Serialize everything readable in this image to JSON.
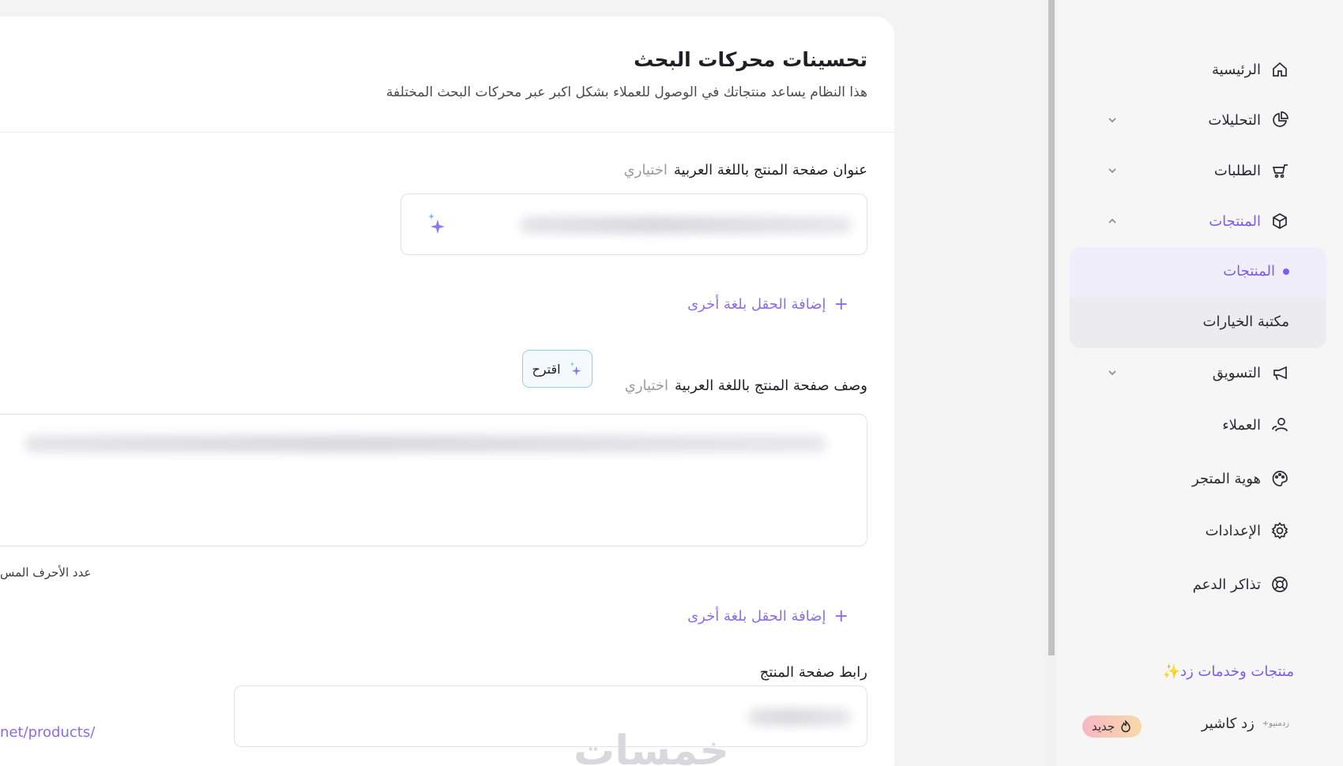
{
  "seo": {
    "title": "تحسينات محركات البحث",
    "subtitle": "هذا النظام يساعد منتجاتك في الوصول للعملاء بشكل اكبر عبر محركات البحث المختلفة",
    "title_field": {
      "label": "عنوان صفحة المنتج باللغة العربية",
      "optional": "اختياري"
    },
    "add_language_label": "إضافة الحقل بلغة أخرى",
    "description_field": {
      "label": "وصف صفحة المنتج باللغة العربية",
      "optional": "اختياري"
    },
    "suggest_label": "اقترح",
    "char_count_label": "عدد الأحرف المس",
    "url_field": {
      "label": "رابط صفحة المنتج",
      "prefix": "net/products/"
    },
    "watermark": "خمسات"
  },
  "sidebar": {
    "items": [
      {
        "label": "الرئيسية",
        "icon": "home-icon"
      },
      {
        "label": "التحليلات",
        "icon": "pie-chart-icon",
        "chevron": "down"
      },
      {
        "label": "الطلبات",
        "icon": "cart-icon",
        "chevron": "down"
      },
      {
        "label": "المنتجات",
        "icon": "box-icon",
        "chevron": "up",
        "active": true
      },
      {
        "label": "التسويق",
        "icon": "megaphone-icon",
        "chevron": "down"
      },
      {
        "label": "العملاء",
        "icon": "users-icon"
      },
      {
        "label": "هوية المتجر",
        "icon": "palette-icon"
      },
      {
        "label": "الإعدادات",
        "icon": "gear-icon"
      },
      {
        "label": "تذاكر الدعم",
        "icon": "lifebuoy-icon"
      }
    ],
    "subitems": [
      {
        "label": "المنتجات",
        "active": true
      },
      {
        "label": "مكتبة الخيارات"
      }
    ],
    "services_label": "منتجات وخدمات زد✨",
    "cashier_label": "زد كاشير",
    "cashier_logo": "زدمنيو+",
    "new_badge": "جديد"
  },
  "colors": {
    "accent": "#7b5cf0",
    "link": "#8a6cf0",
    "suggest_border": "#8fd0f0"
  }
}
